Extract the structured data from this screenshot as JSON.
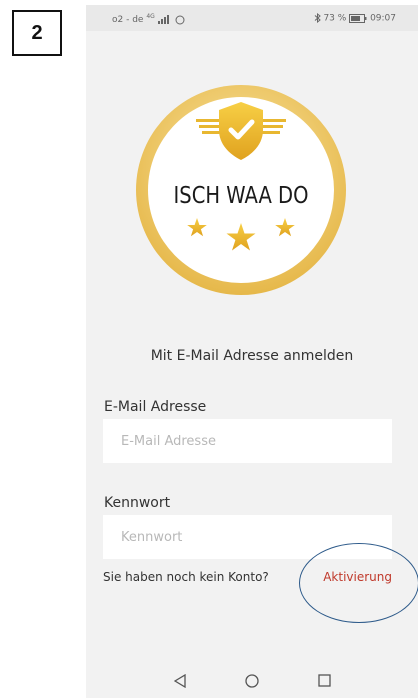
{
  "annotation": {
    "step_number": "2"
  },
  "statusbar": {
    "carrier": "o2 - de",
    "network": "4G",
    "battery": "73 %",
    "time": "09:07"
  },
  "logo": {
    "title": "ISCH WAA DO",
    "colors": {
      "gold": "#e8b730",
      "gold_dark": "#d79c1f",
      "ring": "#f1d07a"
    },
    "icons": [
      "shield-check-icon",
      "star-icon"
    ]
  },
  "login": {
    "heading": "Mit E-Mail Adresse anmelden",
    "email_label": "E-Mail Adresse",
    "email_placeholder": "E-Mail Adresse",
    "password_label": "Kennwort",
    "password_placeholder": "Kennwort",
    "no_account_text": "Sie haben noch kein Konto?",
    "activation_link": "Aktivierung",
    "activation_color": "#c0392b"
  }
}
